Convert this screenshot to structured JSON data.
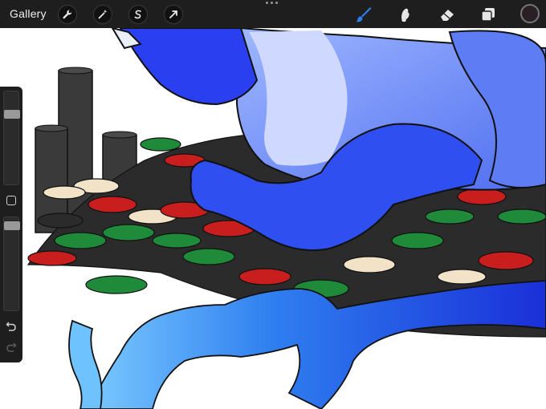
{
  "app": {
    "gallery_label": "Gallery"
  },
  "toolbar_left": [
    {
      "name": "actions-wrench-icon"
    },
    {
      "name": "adjustments-magic-wand-icon"
    },
    {
      "name": "selection-s-icon"
    },
    {
      "name": "transform-arrow-icon"
    }
  ],
  "toolbar_right": [
    {
      "name": "brush-icon",
      "active": true
    },
    {
      "name": "smudge-icon",
      "active": false
    },
    {
      "name": "eraser-icon",
      "active": false
    },
    {
      "name": "layers-icon",
      "active": false
    }
  ],
  "colors": {
    "toolbar_bg": "#1e1e1e",
    "active_tool": "#2f7ff0",
    "inactive_tool": "#e6e6e6",
    "current_color": "#2a1f24"
  },
  "sidebar": {
    "brush_size_level": 0.78,
    "opacity_level": 0.95
  }
}
